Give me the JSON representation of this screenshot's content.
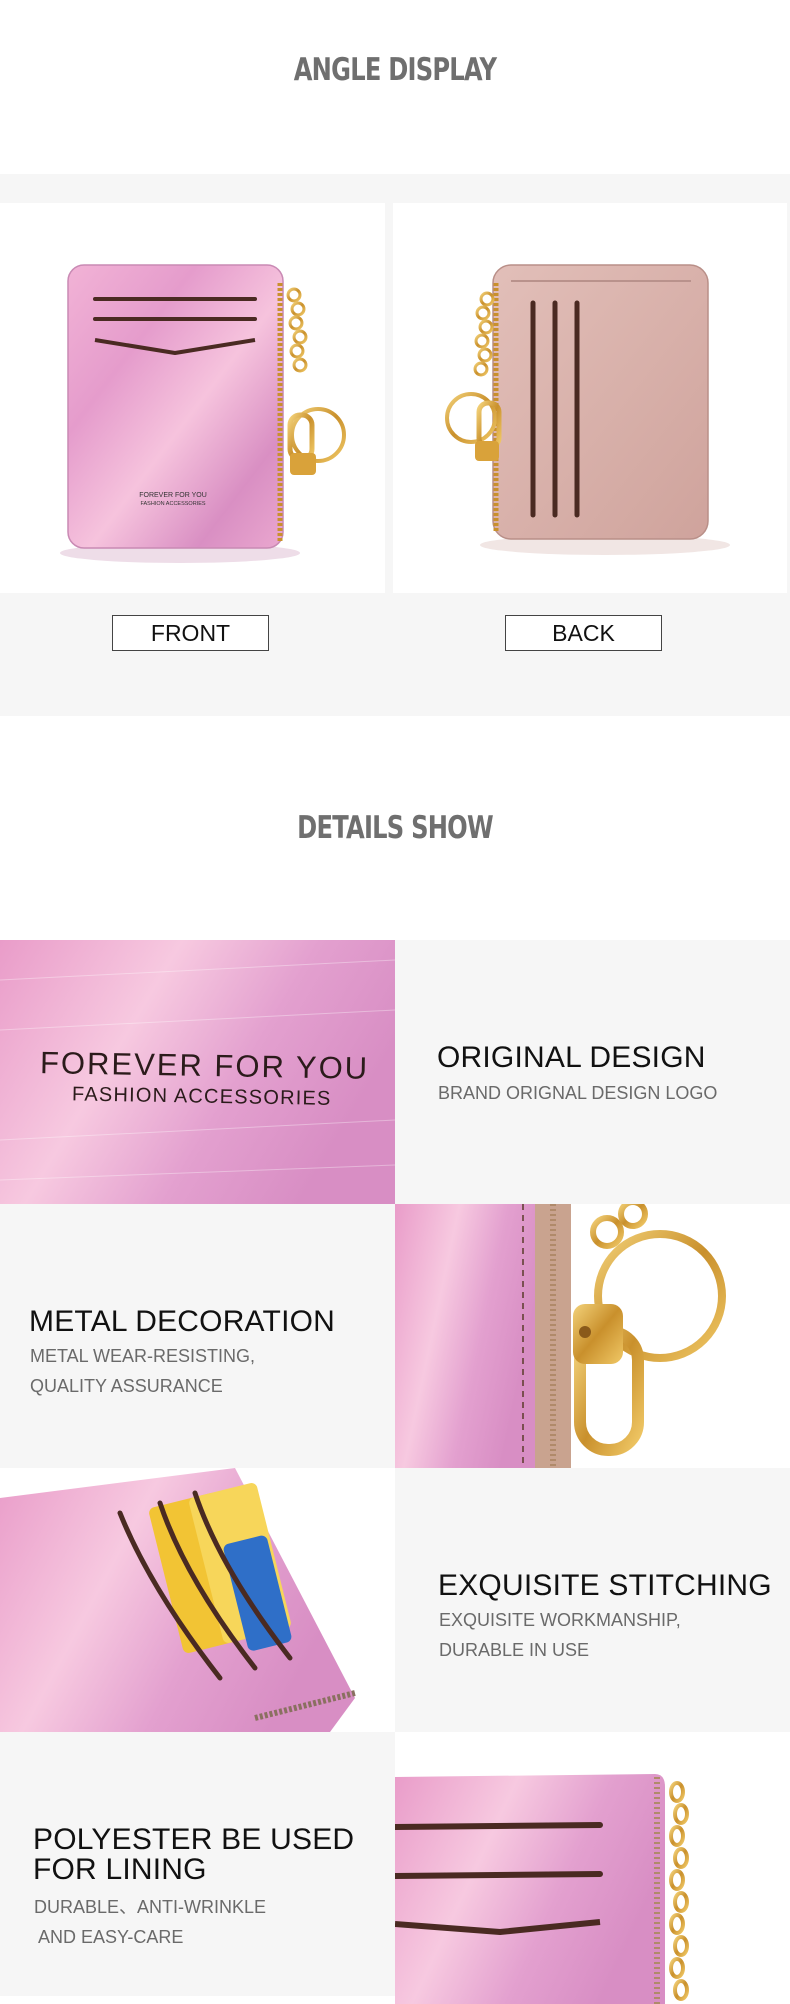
{
  "angle": {
    "title": "ANGLE DISPLAY",
    "front_label": "FRONT",
    "back_label": "BACK",
    "front_brand_line1": "FOREVER FOR YOU",
    "front_brand_line2": "FASHION ACCESSORIES"
  },
  "details": {
    "title": "DETAILS SHOW",
    "logo_line1": "FOREVER FOR YOU",
    "logo_line2": "FASHION ACCESSORIES",
    "features": [
      {
        "title": "ORIGINAL DESIGN",
        "desc_line1": "BRAND  ORIGNAL DESIGN LOGO",
        "desc_line2": ""
      },
      {
        "title": "METAL DECORATION",
        "desc_line1": "METAL WEAR-RESISTING,",
        "desc_line2": "QUALITY ASSURANCE"
      },
      {
        "title": "EXQUISITE STITCHING",
        "desc_line1": "EXQUISITE WORKMANSHIP,",
        "desc_line2": "DURABLE IN USE"
      },
      {
        "title_line1": "POLYESTER BE USED",
        "title_line2": "FOR LINING",
        "desc_line1": "DURABLE、ANTI-WRINKLE",
        "desc_line2": " AND EASY-CARE"
      }
    ]
  },
  "colors": {
    "pink_holo": "#e7a3cc",
    "nude": "#d9b3ad",
    "gold": "#d9a23a",
    "stitch": "#4a2a22"
  }
}
